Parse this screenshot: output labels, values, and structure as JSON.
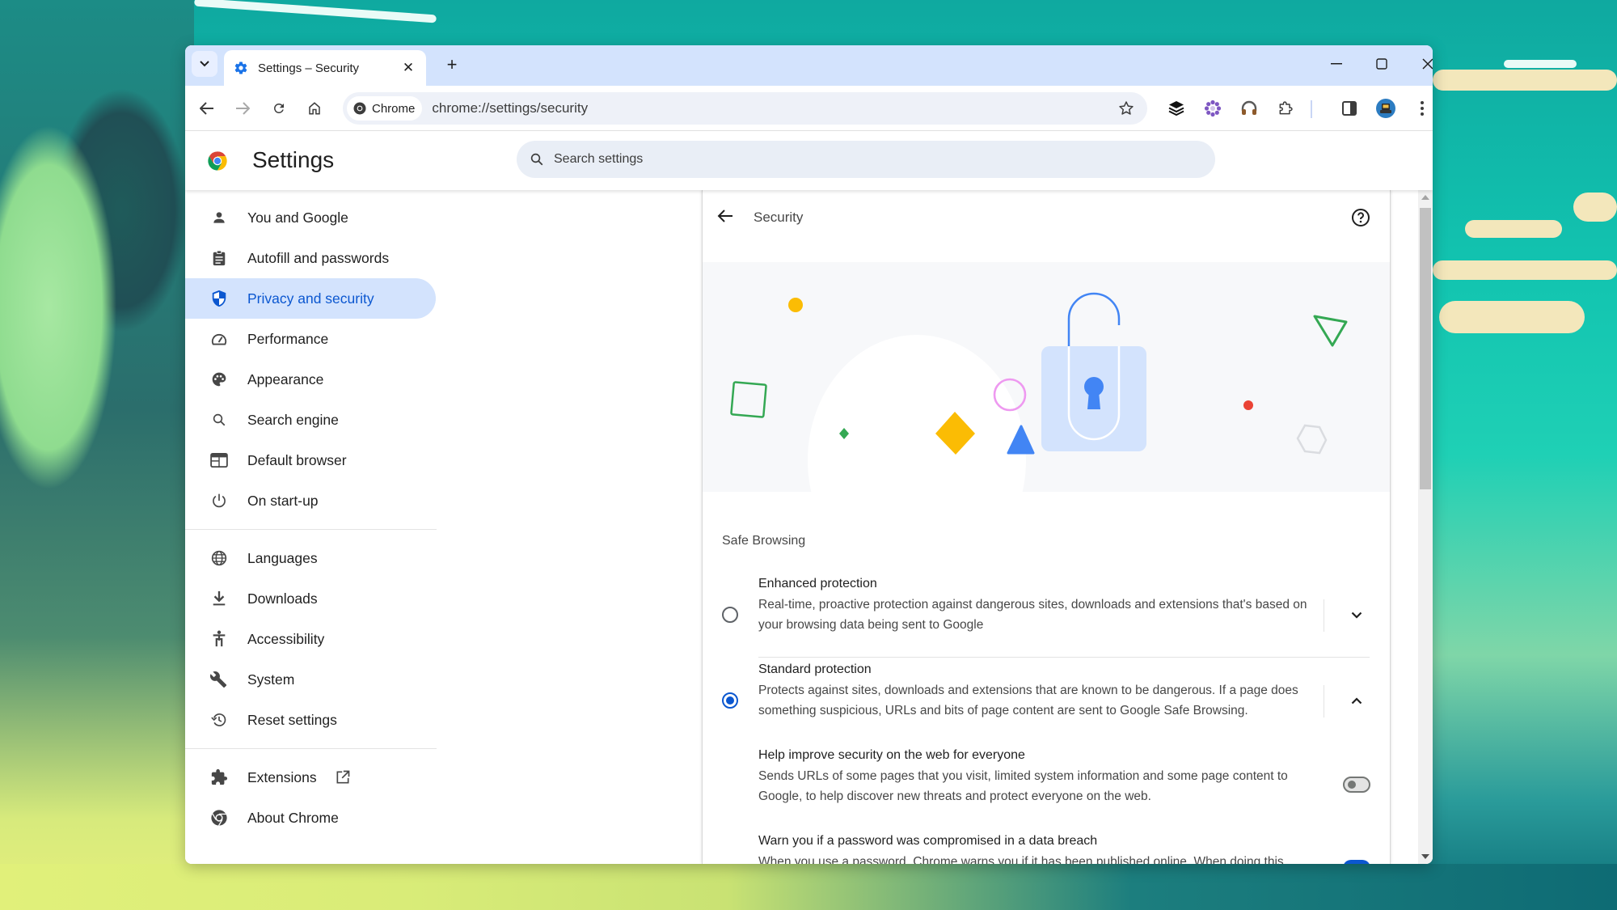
{
  "window": {
    "tab": {
      "title": "Settings – Security",
      "favicon": "gear-icon"
    },
    "controls": [
      "minimize",
      "maximize",
      "close"
    ]
  },
  "toolbar": {
    "back": "back-arrow-icon",
    "forward": "forward-arrow-icon",
    "reload": "reload-icon",
    "home": "home-icon",
    "chip_label": "Chrome",
    "url": "chrome://settings/security",
    "extensions": [
      "layers-extension",
      "flower-extension",
      "headphones-extension",
      "puzzle-extensions-menu"
    ],
    "side_panel": "side-panel-icon",
    "profile": "profile-avatar",
    "menu": "more-vert-icon"
  },
  "header": {
    "title": "Settings",
    "search_placeholder": "Search settings"
  },
  "sidebar": {
    "items": [
      {
        "label": "You and Google",
        "icon": "person-icon",
        "active": false
      },
      {
        "label": "Autofill and passwords",
        "icon": "clipboard-icon",
        "active": false
      },
      {
        "label": "Privacy and security",
        "icon": "shield-icon",
        "active": true
      },
      {
        "label": "Performance",
        "icon": "speedometer-icon",
        "active": false
      },
      {
        "label": "Appearance",
        "icon": "palette-icon",
        "active": false
      },
      {
        "label": "Search engine",
        "icon": "search-icon",
        "active": false
      },
      {
        "label": "Default browser",
        "icon": "browser-window-icon",
        "active": false
      },
      {
        "label": "On start-up",
        "icon": "power-icon",
        "active": false
      },
      {
        "label": "Languages",
        "icon": "globe-icon",
        "active": false
      },
      {
        "label": "Downloads",
        "icon": "download-icon",
        "active": false
      },
      {
        "label": "Accessibility",
        "icon": "accessibility-icon",
        "active": false
      },
      {
        "label": "System",
        "icon": "wrench-icon",
        "active": false
      },
      {
        "label": "Reset settings",
        "icon": "history-icon",
        "active": false
      },
      {
        "label": "Extensions",
        "icon": "puzzle-icon",
        "active": false
      },
      {
        "label": "About Chrome",
        "icon": "chrome-icon",
        "active": false
      }
    ]
  },
  "main": {
    "page_title": "Security",
    "section_title": "Safe Browsing",
    "options": [
      {
        "title": "Enhanced protection",
        "description": "Real-time, proactive protection against dangerous sites, downloads and extensions that's based on your browsing data being sent to Google",
        "selected": false,
        "expanded": false
      },
      {
        "title": "Standard protection",
        "description": "Protects against sites, downloads and extensions that are known to be dangerous. If a page does something suspicious, URLs and bits of page content are sent to Google Safe Browsing.",
        "selected": true,
        "expanded": true
      }
    ],
    "sub_settings": [
      {
        "title": "Help improve security on the web for everyone",
        "description": "Sends URLs of some pages that you visit, limited system information and some page content to Google, to help discover new threats and protect everyone on the web.",
        "enabled": false
      },
      {
        "title": "Warn you if a password was compromised in a data breach",
        "description": "When you use a password, Chrome warns you if it has been published online. When doing this,",
        "enabled": true
      }
    ]
  },
  "colors": {
    "accent": "#0b57d0",
    "active_nav_bg": "#d3e3fd",
    "tabstrip_bg": "#d3e3fd"
  }
}
